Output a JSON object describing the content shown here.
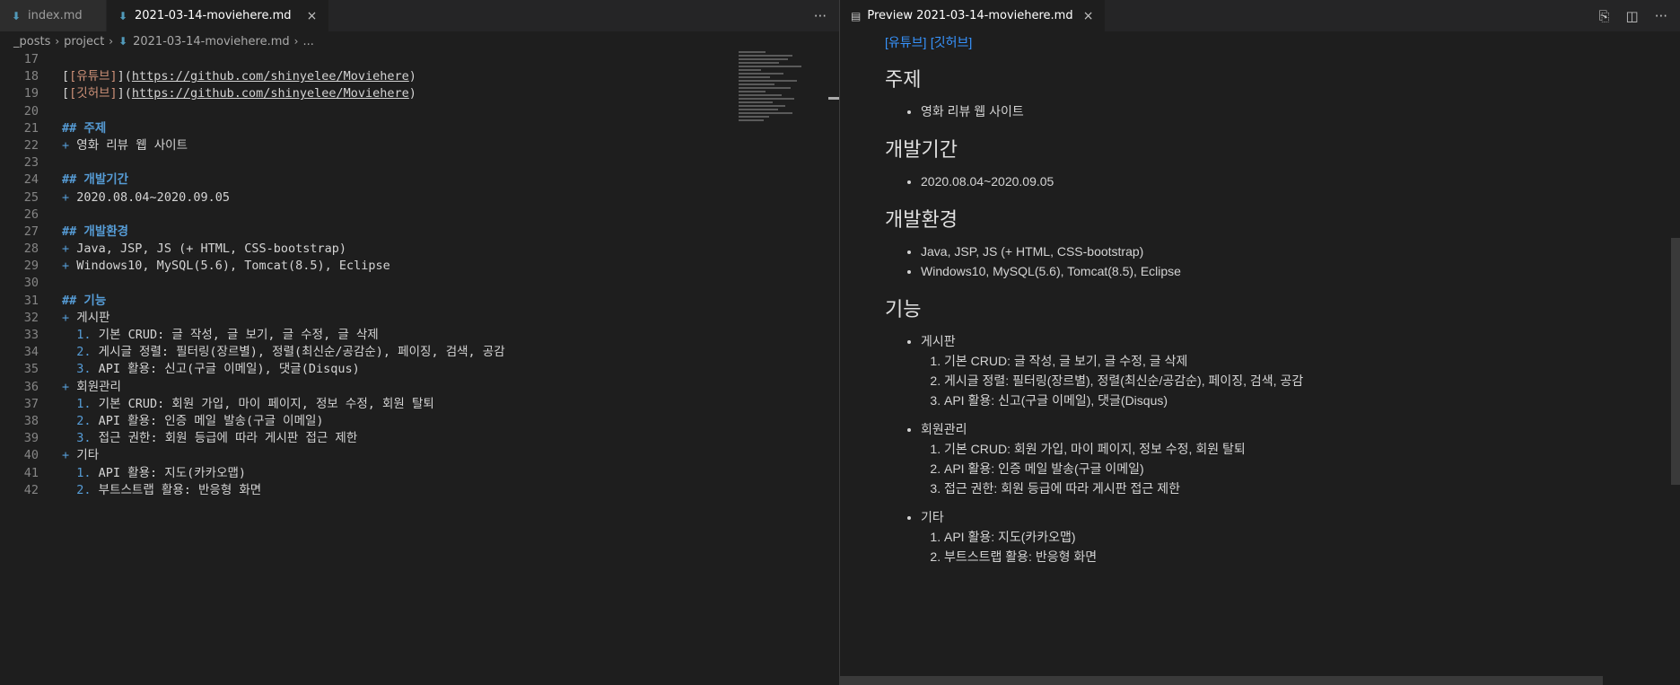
{
  "editor": {
    "tabs": [
      {
        "label": "index.md",
        "active": false
      },
      {
        "label": "2021-03-14-moviehere.md",
        "active": true
      }
    ],
    "more_icon": "ellipsis-icon",
    "breadcrumb": [
      "_posts",
      "project",
      "2021-03-14-moviehere.md",
      "..."
    ],
    "lines": {
      "l17": {
        "num": "17"
      },
      "l18": {
        "num": "18",
        "bracket_open": "[",
        "link_text": "[유튜브]",
        "bracket_mid": "](",
        "url": "https://github.com/shinyelee/Moviehere",
        "close": ")"
      },
      "l19": {
        "num": "19",
        "bracket_open": "[",
        "link_text": "[깃허브]",
        "bracket_mid": "](",
        "url": "https://github.com/shinyelee/Moviehere",
        "close": ")"
      },
      "l20": {
        "num": "20"
      },
      "l21": {
        "num": "21",
        "marker": "##",
        "text": "주제"
      },
      "l22": {
        "num": "22",
        "marker": "+",
        "text": "영화 리뷰 웹 사이트"
      },
      "l23": {
        "num": "23"
      },
      "l24": {
        "num": "24",
        "marker": "##",
        "text": "개발기간"
      },
      "l25": {
        "num": "25",
        "marker": "+",
        "text": "2020.08.04~2020.09.05"
      },
      "l26": {
        "num": "26"
      },
      "l27": {
        "num": "27",
        "marker": "##",
        "text": "개발환경"
      },
      "l28": {
        "num": "28",
        "marker": "+",
        "text": "Java, JSP, JS (+ HTML, CSS-bootstrap)"
      },
      "l29": {
        "num": "29",
        "marker": "+",
        "text": "Windows10, MySQL(5.6), Tomcat(8.5), Eclipse"
      },
      "l30": {
        "num": "30"
      },
      "l31": {
        "num": "31",
        "marker": "##",
        "text": "기능"
      },
      "l32": {
        "num": "32",
        "marker": "+",
        "text": "게시판"
      },
      "l33": {
        "num": "33",
        "marker": "1.",
        "text": "기본 CRUD: 글 작성, 글 보기, 글 수정, 글 삭제"
      },
      "l34": {
        "num": "34",
        "marker": "2.",
        "text": "게시글 정렬: 필터링(장르별), 정렬(최신순/공감순), 페이징, 검색, 공감"
      },
      "l35": {
        "num": "35",
        "marker": "3.",
        "text": "API 활용: 신고(구글 이메일), 댓글(Disqus)"
      },
      "l36": {
        "num": "36",
        "marker": "+",
        "text": "회원관리"
      },
      "l37": {
        "num": "37",
        "marker": "1.",
        "text": "기본 CRUD: 회원 가입, 마이 페이지, 정보 수정, 회원 탈퇴"
      },
      "l38": {
        "num": "38",
        "marker": "2.",
        "text": "API 활용: 인증 메일 발송(구글 이메일)"
      },
      "l39": {
        "num": "39",
        "marker": "3.",
        "text": "접근 권한: 회원 등급에 따라 게시판 접근 제한"
      },
      "l40": {
        "num": "40",
        "marker": "+",
        "text": "기타"
      },
      "l41": {
        "num": "41",
        "marker": "1.",
        "text": "API 활용: 지도(카카오맵)"
      },
      "l42": {
        "num": "42",
        "marker": "2.",
        "text": "부트스트랩 활용: 반응형 화면"
      }
    }
  },
  "preview": {
    "tab_label": "Preview 2021-03-14-moviehere.md",
    "links": {
      "youtube": "[유튜브]",
      "github": "[깃허브]"
    },
    "h_topic": "주제",
    "topic_item": "영화 리뷰 웹 사이트",
    "h_period": "개발기간",
    "period_item": "2020.08.04~2020.09.05",
    "h_env": "개발환경",
    "env_items": [
      "Java, JSP, JS (+ HTML, CSS-bootstrap)",
      "Windows10, MySQL(5.6), Tomcat(8.5), Eclipse"
    ],
    "h_features": "기능",
    "board": {
      "label": "게시판",
      "items": [
        "기본 CRUD: 글 작성, 글 보기, 글 수정, 글 삭제",
        "게시글 정렬: 필터링(장르별), 정렬(최신순/공감순), 페이징, 검색, 공감",
        "API 활용: 신고(구글 이메일), 댓글(Disqus)"
      ]
    },
    "members": {
      "label": "회원관리",
      "items": [
        "기본 CRUD: 회원 가입, 마이 페이지, 정보 수정, 회원 탈퇴",
        "API 활용: 인증 메일 발송(구글 이메일)",
        "접근 권한: 회원 등급에 따라 게시판 접근 제한"
      ]
    },
    "etc": {
      "label": "기타",
      "items": [
        "API 활용: 지도(카카오맵)",
        "부트스트랩 활용: 반응형 화면"
      ]
    }
  }
}
